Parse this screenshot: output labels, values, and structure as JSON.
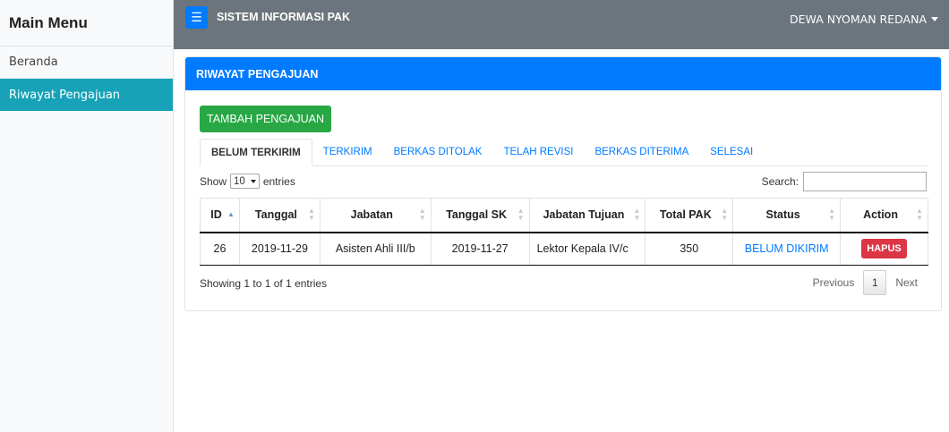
{
  "sidebar": {
    "title": "Main Menu",
    "items": [
      {
        "label": "Beranda",
        "active": false
      },
      {
        "label": "Riwayat Pengajuan",
        "active": true
      }
    ]
  },
  "navbar": {
    "toggle_icon": "hamburger-icon",
    "brand": "SISTEM INFORMASI PAK",
    "user": "DEWA NYOMAN REDANA"
  },
  "card": {
    "title": "RIWAYAT PENGAJUAN",
    "add_button": "TAMBAH PENGAJUAN",
    "tabs": [
      "BELUM TERKIRIM",
      "TERKIRIM",
      "BERKAS DITOLAK",
      "TELAH REVISI",
      "BERKAS DITERIMA",
      "SELESAI"
    ],
    "active_tab": 0
  },
  "table_controls": {
    "show_label": "Show",
    "entries_value": "10",
    "entries_label": "entries",
    "search_label": "Search:",
    "search_value": ""
  },
  "table": {
    "columns": [
      "ID",
      "Tanggal",
      "Jabatan",
      "Tanggal SK",
      "Jabatan Tujuan",
      "Total PAK",
      "Status",
      "Action"
    ],
    "rows": [
      {
        "id": "26",
        "tanggal": "2019-11-29",
        "jabatan": "Asisten Ahli III/b",
        "tanggal_sk": "2019-11-27",
        "jabatan_tujuan": "Lektor Kepala IV/c",
        "total_pak": "350",
        "status": "BELUM DIKIRIM",
        "action": "HAPUS"
      }
    ]
  },
  "footer": {
    "info": "Showing 1 to 1 of 1 entries",
    "previous": "Previous",
    "page": "1",
    "next": "Next"
  },
  "colors": {
    "primary": "#007bff",
    "success": "#28a745",
    "danger": "#dc3545",
    "info": "#17a2b8",
    "navbar": "#6c757d"
  }
}
